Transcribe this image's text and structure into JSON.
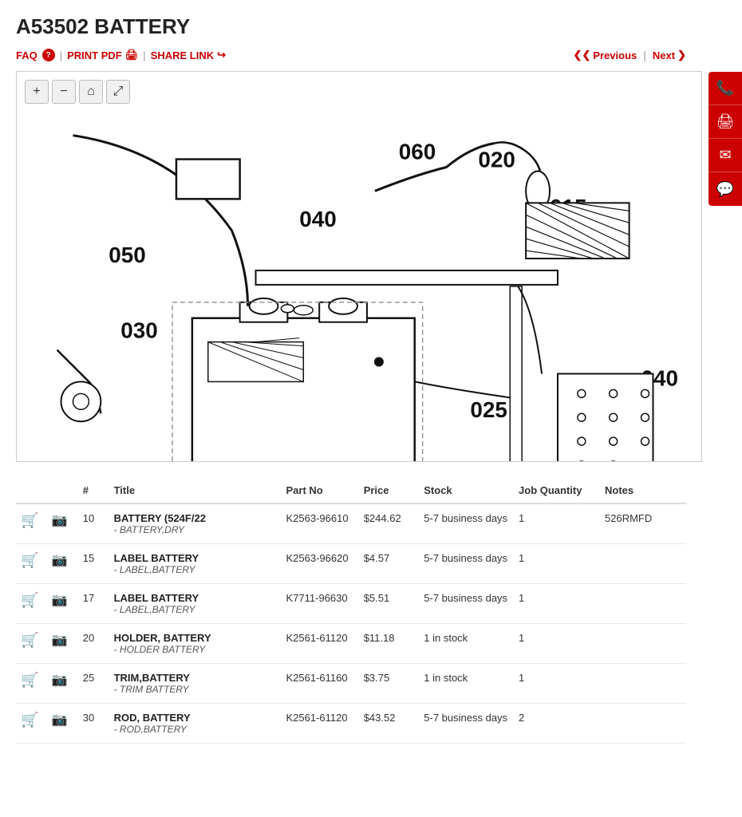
{
  "page": {
    "title": "A53502 BATTERY"
  },
  "toolbar": {
    "faq_label": "FAQ",
    "print_label": "PRINT PDF",
    "share_label": "SHARE LINK",
    "sep": "|",
    "prev_label": "Previous",
    "next_label": "Next"
  },
  "diagram": {
    "controls": {
      "zoom_in": "+",
      "zoom_out": "−",
      "home": "⌂",
      "fullscreen": "⤢"
    }
  },
  "table": {
    "headers": {
      "cart": "",
      "photo": "",
      "num": "#",
      "title": "Title",
      "partno": "Part No",
      "price": "Price",
      "stock": "Stock",
      "qty": "Job Quantity",
      "notes": "Notes"
    },
    "rows": [
      {
        "num": "10",
        "title": "BATTERY (524F/22",
        "subtitle": "- BATTERY,DRY",
        "partno": "K2563-96610",
        "price": "$244.62",
        "stock": "5-7 business days",
        "qty": "1",
        "notes": "526RMFD"
      },
      {
        "num": "15",
        "title": "LABEL BATTERY",
        "subtitle": "- LABEL,BATTERY",
        "partno": "K2563-96620",
        "price": "$4.57",
        "stock": "5-7 business days",
        "qty": "1",
        "notes": ""
      },
      {
        "num": "17",
        "title": "LABEL BATTERY",
        "subtitle": "- LABEL,BATTERY",
        "partno": "K7711-96630",
        "price": "$5.51",
        "stock": "5-7 business days",
        "qty": "1",
        "notes": ""
      },
      {
        "num": "20",
        "title": "HOLDER, BATTERY",
        "subtitle": "- HOLDER BATTERY",
        "partno": "K2561-61120",
        "price": "$11.18",
        "stock": "1 in stock",
        "qty": "1",
        "notes": ""
      },
      {
        "num": "25",
        "title": "TRIM,BATTERY",
        "subtitle": "- TRIM BATTERY",
        "partno": "K2561-61160",
        "price": "$3.75",
        "stock": "1 in stock",
        "qty": "1",
        "notes": ""
      },
      {
        "num": "30",
        "title": "ROD, BATTERY",
        "subtitle": "- ROD,BATTERY",
        "partno": "K2561-61120",
        "price": "$43.52",
        "stock": "5-7 business days",
        "qty": "2",
        "notes": ""
      }
    ]
  },
  "sidebar": {
    "icons": [
      "phone",
      "print",
      "mail",
      "comment"
    ]
  }
}
